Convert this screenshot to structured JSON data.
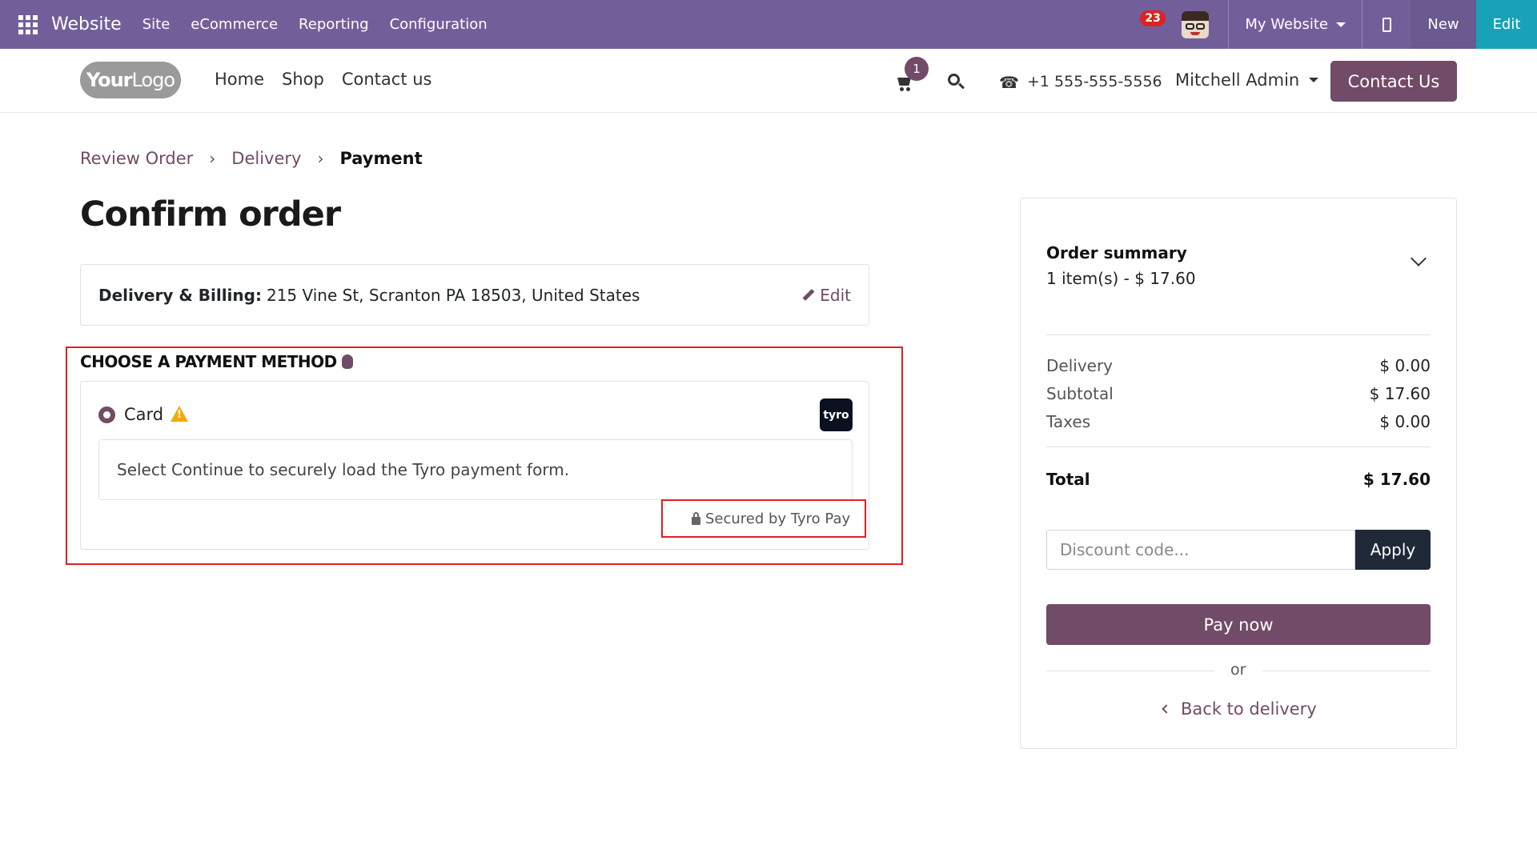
{
  "topbar": {
    "brand": "Website",
    "menus": [
      "Site",
      "eCommerce",
      "Reporting",
      "Configuration"
    ],
    "notifications_count": "23",
    "website_selector": "My Website",
    "new_label": "New",
    "edit_label": "Edit"
  },
  "header": {
    "logo_bold": "Your",
    "logo_thin": "Logo",
    "nav": [
      "Home",
      "Shop",
      "Contact us"
    ],
    "cart_count": "1",
    "phone": "+1 555-555-5556",
    "user": "Mitchell Admin",
    "contact_button": "Contact Us"
  },
  "breadcrumb": {
    "step1": "Review Order",
    "step2": "Delivery",
    "step3": "Payment"
  },
  "page_title": "Confirm order",
  "address": {
    "label": "Delivery & Billing:",
    "value": "215 Vine St, Scranton PA 18503, United States",
    "edit_label": "Edit"
  },
  "payment": {
    "heading": "CHOOSE A PAYMENT METHOD",
    "method_label": "Card",
    "provider_logo_text": "tyro",
    "instructions": "Select Continue to securely load the Tyro payment form.",
    "secured_text": "Secured by Tyro Pay"
  },
  "summary": {
    "title": "Order summary",
    "items_text": "1 item(s) -  $ 17.60",
    "rows": [
      {
        "label": "Delivery",
        "value": "$ 0.00"
      },
      {
        "label": "Subtotal",
        "value": "$ 17.60"
      },
      {
        "label": "Taxes",
        "value": "$ 0.00"
      }
    ],
    "total_label": "Total",
    "total_value": "$ 17.60",
    "discount_placeholder": "Discount code...",
    "apply_label": "Apply",
    "pay_label": "Pay now",
    "or_text": "or",
    "back_label": "Back to delivery"
  },
  "colors": {
    "topbar": "#725f9a",
    "brand_primary": "#714b67",
    "edit_button": "#17a2b8",
    "highlight": "#e02020"
  }
}
